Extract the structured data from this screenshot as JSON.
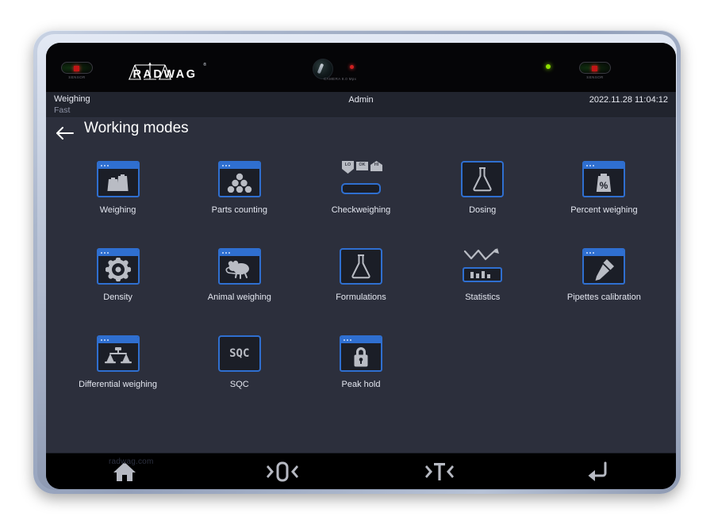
{
  "device": {
    "brand_logo": "RADWAG",
    "registered_mark": "®",
    "sensor_left_label": "SENSOR",
    "sensor_right_label": "SENSOR",
    "camera_label": "CAMERA 8.0 Mpx",
    "footer_brand": "radwag.com",
    "bezel_color": "#050507",
    "frame_color": "#aab6cc"
  },
  "statusbar": {
    "mode": "Weighing",
    "submode": "Fast",
    "user": "Admin",
    "datetime": "2022.11.28 11:04:12"
  },
  "header": {
    "title": "Working modes",
    "back_icon": "arrow-left-icon"
  },
  "theme": {
    "accent": "#2f6fd0",
    "screen_bg": "#2c2f3c",
    "statusbar_bg": "#21242e",
    "icon_bg": "#1b1e27",
    "glyph": "#b9bcc4",
    "text": "#e3e6ef"
  },
  "modes": [
    {
      "label": "Weighing",
      "icon": "weights-icon",
      "style": "window"
    },
    {
      "label": "Parts counting",
      "icon": "balls-pyramid-icon",
      "style": "window"
    },
    {
      "label": "Checkweighing",
      "icon": "lo-ok-hi-bar-icon",
      "style": "checkweighing",
      "tags": [
        "LO",
        "OK",
        "HI"
      ]
    },
    {
      "label": "Dosing",
      "icon": "flask-icon",
      "style": "frame"
    },
    {
      "label": "Percent weighing",
      "icon": "weight-percent-icon",
      "style": "window"
    },
    {
      "label": "Density",
      "icon": "gear-ring-icon",
      "style": "window"
    },
    {
      "label": "Animal weighing",
      "icon": "mouse-icon",
      "style": "window"
    },
    {
      "label": "Formulations",
      "icon": "flask-icon",
      "style": "frame"
    },
    {
      "label": "Statistics",
      "icon": "zigzag-chart-icon",
      "style": "statistics"
    },
    {
      "label": "Pipettes calibration",
      "icon": "pipette-icon",
      "style": "window"
    },
    {
      "label": "Differential weighing",
      "icon": "balance-scale-icon",
      "style": "window"
    },
    {
      "label": "SQC",
      "icon": "sqc-text-icon",
      "style": "frame",
      "text": "SQC"
    },
    {
      "label": "Peak hold",
      "icon": "padlock-icon",
      "style": "window"
    }
  ],
  "navbar": [
    {
      "name": "home",
      "icon": "home-icon",
      "label": "Home"
    },
    {
      "name": "zero",
      "icon": "zero-icon",
      "label": ">0<"
    },
    {
      "name": "tare",
      "icon": "tare-icon",
      "label": ">T<"
    },
    {
      "name": "enter",
      "icon": "enter-icon",
      "label": "Enter"
    }
  ]
}
